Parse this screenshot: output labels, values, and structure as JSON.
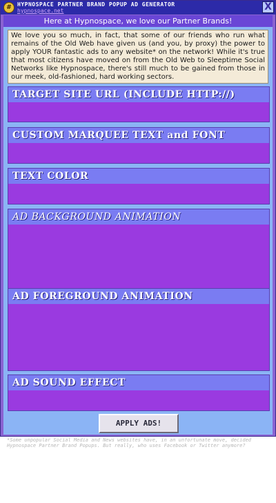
{
  "window": {
    "title": "HYPNOSPACE PARTNER BRAND POPUP AD GENERATOR",
    "url": "hypnospace.net",
    "close_glyph": "X",
    "icon_glyph": "#"
  },
  "banner": "Here at Hypnospace, we love our Partner Brands!",
  "intro": "We love you so much, in fact, that some of our friends who run what remains of the Old Web have given us (and you, by proxy) the power to apply YOUR fantastic ads to any website* on the network! While it's true that most citizens have moved on from the Old Web to Sleeptime Social Networks like Hypnospace, there's still much to be gained from those in our meek, old-fashioned, hard working sectors.",
  "sections": {
    "target_url": "TARGET SITE URL (INCLUDE HTTP://)",
    "marquee": "CUSTOM MARQUEE TEXT and FONT",
    "text_color": "TEXT COLOR",
    "bg_animation": "AD BACKGROUND ANIMATION",
    "fg_animation": "AD FOREGROUND ANIMATION",
    "sound": "AD SOUND EFFECT"
  },
  "apply_button": "APPLY ADS!",
  "footnote": "*Some unpopular Social Media and News websites have, in an unfortunate move, decided Hypnospace Partner Brand Popups. But really, who uses Facebook or Twitter anymore?",
  "colors": {
    "section_header": "#7a7cf2",
    "section_body": "#9a3ae0",
    "panel": "#8bb4f5"
  }
}
